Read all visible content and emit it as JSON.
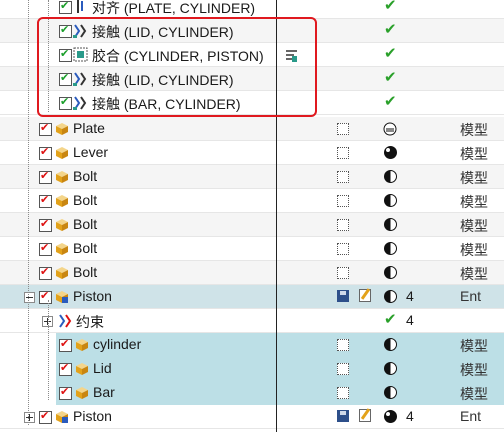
{
  "colors": {
    "highlight_box": "#e0191f",
    "selection": "#bcdfe6",
    "check_green": "#1a9e2a",
    "check_red": "#d11111"
  },
  "rows": [
    {
      "label": "对齐 (PLATE, CYLINDER)",
      "icon": "align-constraint-icon",
      "status": "✔"
    },
    {
      "label": "接触 (LID, CYLINDER)",
      "icon": "contact-constraint-icon",
      "status": "✔"
    },
    {
      "label": "胶合 (CYLINDER, PISTON)",
      "icon": "glue-constraint-icon",
      "status": "✔"
    },
    {
      "label": "接触 (LID, CYLINDER)",
      "icon": "contact-constraint-icon",
      "status": "✔"
    },
    {
      "label": "接触 (BAR, CYLINDER)",
      "icon": "contact-constraint-icon",
      "status": "✔"
    },
    {
      "label": "Plate",
      "type": "模型"
    },
    {
      "label": "Lever",
      "type": "模型"
    },
    {
      "label": "Bolt",
      "type": "模型"
    },
    {
      "label": "Bolt",
      "type": "模型"
    },
    {
      "label": "Bolt",
      "type": "模型"
    },
    {
      "label": "Bolt",
      "type": "模型"
    },
    {
      "label": "Bolt",
      "type": "模型"
    },
    {
      "label": "Piston",
      "count": "4",
      "type": "Ent"
    },
    {
      "label": "约束",
      "status": "✔",
      "count": "4"
    },
    {
      "label": "cylinder",
      "type": "模型"
    },
    {
      "label": "Lid",
      "type": "模型"
    },
    {
      "label": "Bar",
      "type": "模型"
    },
    {
      "label": "Piston",
      "count": "4",
      "type": "Ent"
    }
  ]
}
